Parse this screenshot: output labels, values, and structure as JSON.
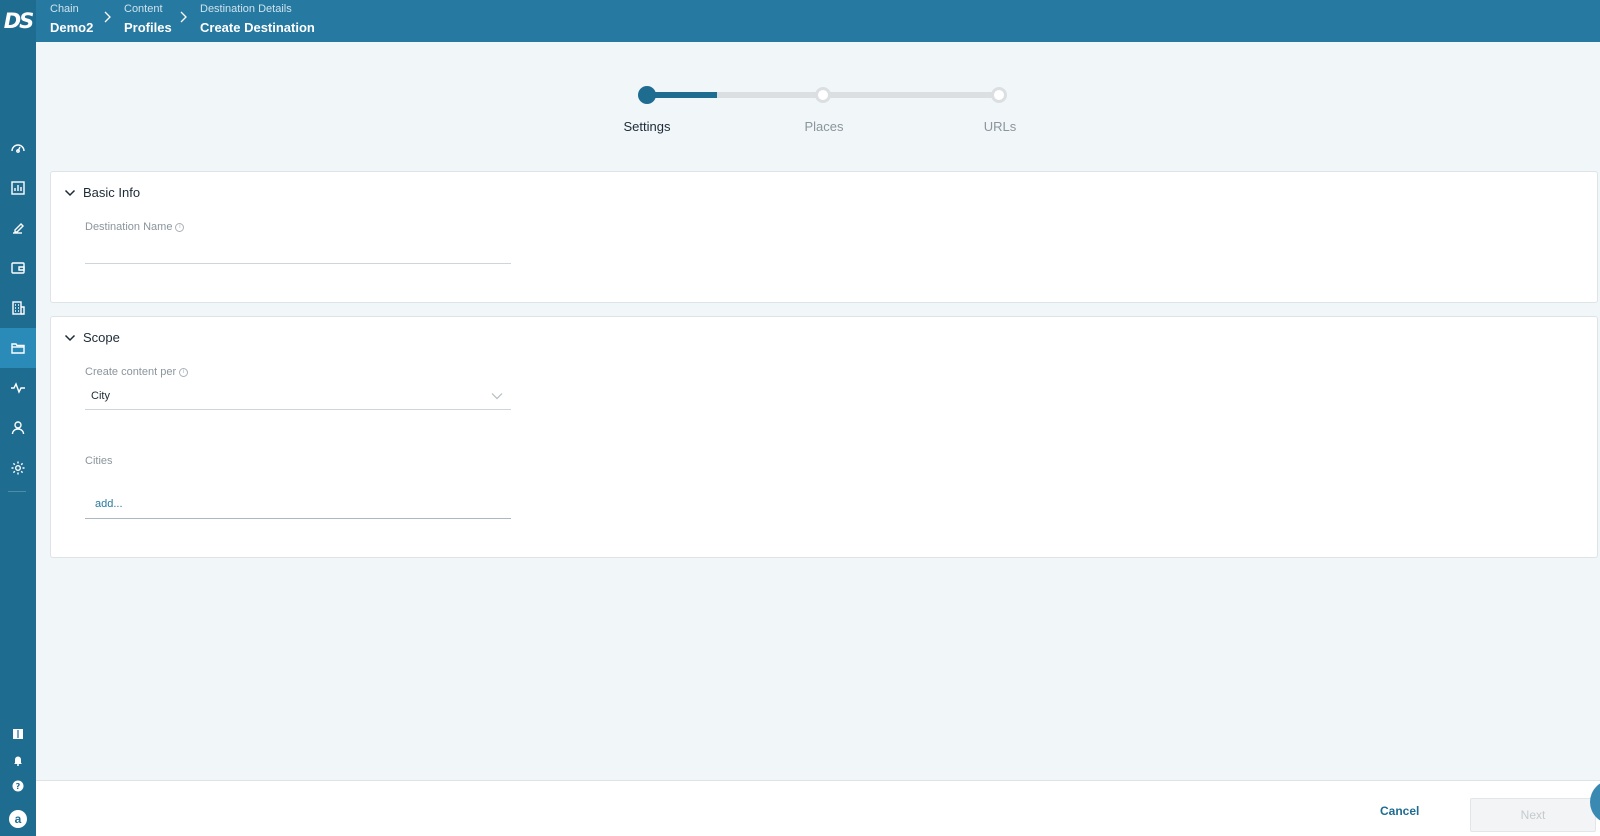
{
  "app": {
    "logo": "DS"
  },
  "breadcrumb": [
    {
      "label": "Chain",
      "value": "Demo2"
    },
    {
      "label": "Content",
      "value": "Profiles"
    },
    {
      "label": "Destination Details",
      "value": "Create Destination"
    }
  ],
  "sidebar": {
    "items": [
      {
        "icon": "dashboard-icon",
        "active": false
      },
      {
        "icon": "reports-icon",
        "active": false
      },
      {
        "icon": "reviews-icon",
        "active": false
      },
      {
        "icon": "wallet-icon",
        "active": false
      },
      {
        "icon": "locations-icon",
        "active": false
      },
      {
        "icon": "folder-icon",
        "active": true
      },
      {
        "icon": "activity-icon",
        "active": false
      },
      {
        "icon": "user-icon",
        "active": false
      },
      {
        "icon": "settings-icon",
        "active": false
      }
    ],
    "bottom": [
      {
        "icon": "book-icon"
      },
      {
        "icon": "bell-icon"
      },
      {
        "icon": "help-icon"
      }
    ],
    "avatar": "a"
  },
  "stepper": {
    "progress": 0.2,
    "steps": [
      {
        "label": "Settings",
        "active": true
      },
      {
        "label": "Places",
        "active": false
      },
      {
        "label": "URLs",
        "active": false
      }
    ]
  },
  "basic_info": {
    "title": "Basic Info",
    "destination_name_label": "Destination Name",
    "destination_name_value": ""
  },
  "scope": {
    "title": "Scope",
    "content_per_label": "Create content per",
    "content_per_value": "City",
    "cities_label": "Cities",
    "cities_placeholder": "add..."
  },
  "footer": {
    "cancel_label": "Cancel",
    "next_label": "Next"
  },
  "colors": {
    "sidebar": "#1f6c91",
    "header": "#2679a0",
    "accent": "#1f6c91",
    "background": "#f1f6f9"
  }
}
